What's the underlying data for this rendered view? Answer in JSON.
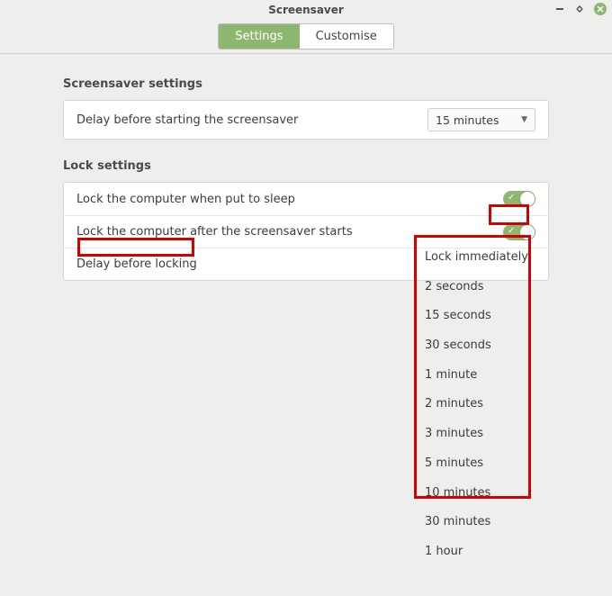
{
  "window": {
    "title": "Screensaver"
  },
  "tabs": {
    "settings": "Settings",
    "customise": "Customise"
  },
  "screensaver_section": {
    "heading": "Screensaver settings",
    "delay_label": "Delay before starting the screensaver",
    "delay_value": "15 minutes"
  },
  "lock_section": {
    "heading": "Lock settings",
    "lock_sleep_label": "Lock the computer when put to sleep",
    "lock_sleep_on": true,
    "lock_after_ss_label": "Lock the computer after the screensaver starts",
    "lock_after_ss_on": true,
    "delay_before_locking_label": "Delay before locking",
    "delay_options": [
      "Lock immediately",
      "2 seconds",
      "15 seconds",
      "30 seconds",
      "1 minute",
      "2 minutes",
      "3 minutes",
      "5 minutes",
      "10 minutes",
      "30 minutes",
      "1 hour"
    ]
  },
  "colors": {
    "accent": "#8db670",
    "annotation_border": "#d40000"
  }
}
